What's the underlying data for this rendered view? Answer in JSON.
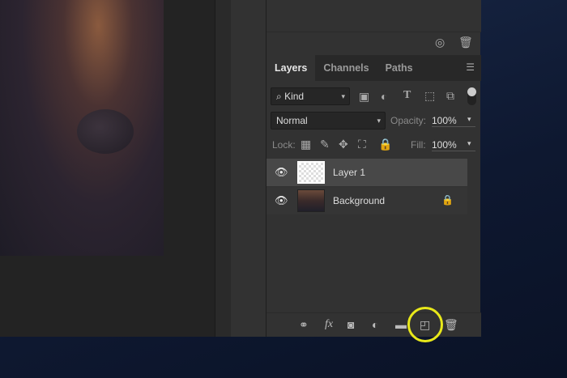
{
  "tabs": [
    {
      "label": "Layers"
    },
    {
      "label": "Channels"
    },
    {
      "label": "Paths"
    }
  ],
  "filter": {
    "kind": "Kind"
  },
  "blend": {
    "mode": "Normal",
    "opacity_label": "Opacity:",
    "opacity": "100%"
  },
  "lock": {
    "label": "Lock:",
    "fill_label": "Fill:",
    "fill": "100%"
  },
  "layers": [
    {
      "name": "Layer 1",
      "visible": true,
      "selected": true
    },
    {
      "name": "Background",
      "visible": true,
      "locked": true
    }
  ],
  "bottom_icons": [
    "link-icon",
    "fx-icon",
    "mask-icon",
    "adjustment-icon",
    "folder-icon",
    "new-layer-icon",
    "trash-icon"
  ],
  "bottom": {
    "fx": "fx"
  },
  "highlight_color": "#e8e81a"
}
